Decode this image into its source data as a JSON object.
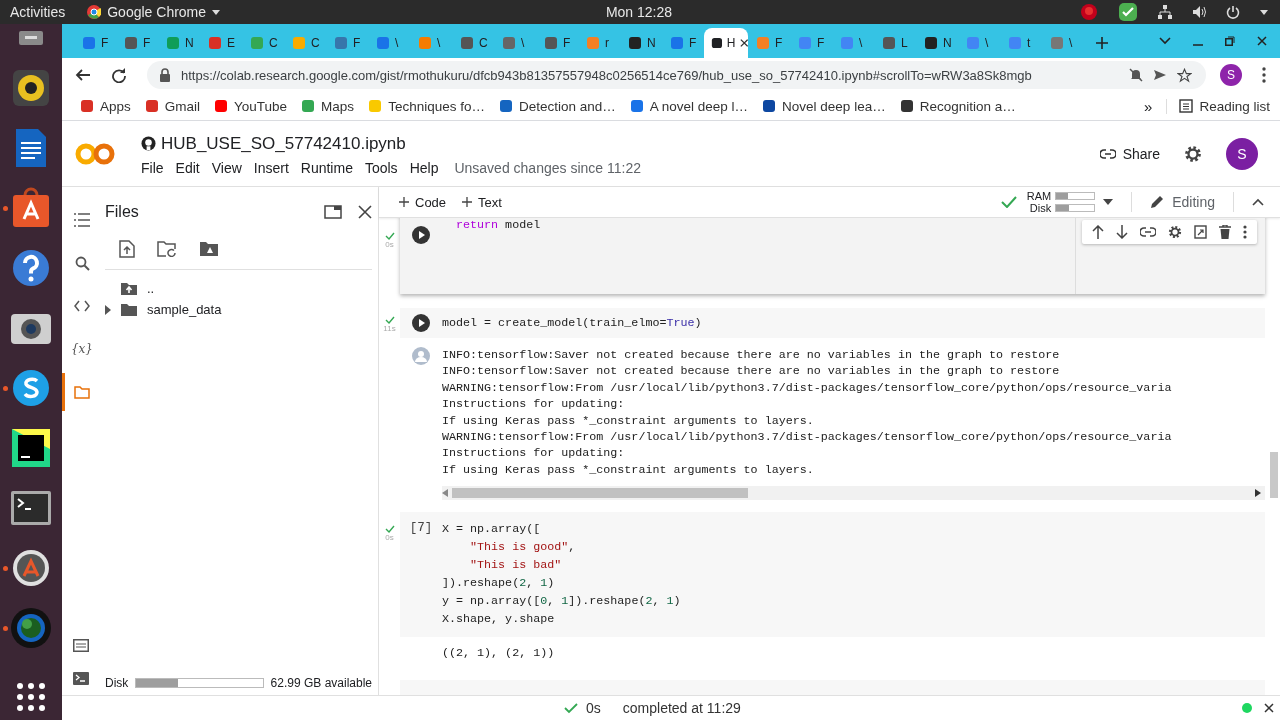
{
  "topbar": {
    "activities": "Activities",
    "app": "Google Chrome",
    "clock": "Mon 12:28"
  },
  "dock": [
    {
      "running": false
    },
    {
      "running": false
    },
    {
      "running": false
    },
    {
      "running": true
    },
    {
      "running": false
    },
    {
      "running": false
    },
    {
      "running": true
    },
    {
      "running": false
    },
    {
      "running": false
    },
    {
      "running": true
    },
    {
      "running": true
    }
  ],
  "tabs": [
    {
      "label": "F",
      "selected": false
    },
    {
      "label": "F",
      "selected": false
    },
    {
      "label": "N",
      "selected": false
    },
    {
      "label": "E",
      "selected": false
    },
    {
      "label": "C",
      "selected": false
    },
    {
      "label": "C",
      "selected": false
    },
    {
      "label": "F",
      "selected": false
    },
    {
      "label": "\\",
      "selected": false
    },
    {
      "label": "\\",
      "selected": false
    },
    {
      "label": "C",
      "selected": false
    },
    {
      "label": "\\",
      "selected": false
    },
    {
      "label": "F",
      "selected": false
    },
    {
      "label": "r",
      "selected": false
    },
    {
      "label": "N",
      "selected": false
    },
    {
      "label": "F",
      "selected": false
    },
    {
      "label": "H",
      "selected": true
    },
    {
      "label": "F",
      "selected": false
    },
    {
      "label": "F",
      "selected": false
    },
    {
      "label": "\\",
      "selected": false
    },
    {
      "label": "L",
      "selected": false
    },
    {
      "label": "N",
      "selected": false
    },
    {
      "label": "\\",
      "selected": false
    },
    {
      "label": "t",
      "selected": false
    },
    {
      "label": "\\",
      "selected": false
    }
  ],
  "address": {
    "url": "https://colab.research.google.com/gist/rmothukuru/dfcb943b81357557948c0256514ce769/hub_use_so_57742410.ipynb#scrollTo=wRW3a8Sk8mgb",
    "profile": "S"
  },
  "bookmarks": [
    {
      "label": "Apps"
    },
    {
      "label": "Gmail"
    },
    {
      "label": "YouTube"
    },
    {
      "label": "Maps"
    },
    {
      "label": "Techniques fo…"
    },
    {
      "label": "Detection and…"
    },
    {
      "label": "A novel deep l…"
    },
    {
      "label": "Novel deep lea…"
    },
    {
      "label": "Recognition a…"
    }
  ],
  "bookmarks_more": "»",
  "reading_list": "Reading list",
  "notebook": {
    "title": "HUB_USE_SO_57742410.ipynb",
    "menu": [
      "File",
      "Edit",
      "View",
      "Insert",
      "Runtime",
      "Tools",
      "Help"
    ],
    "unsaved": "Unsaved changes since 11:22",
    "share": "Share",
    "avatar": "S"
  },
  "toolbar": {
    "add_code": "Code",
    "add_text": "Text",
    "ram": {
      "label": "RAM",
      "level": 0.3
    },
    "disk": {
      "label": "Disk",
      "level": 0.35
    },
    "mode": "Editing"
  },
  "rail": [
    {
      "selected": false
    },
    {
      "selected": false
    },
    {
      "selected": false
    },
    {
      "glyph": "{x}",
      "selected": false
    },
    {
      "selected": true
    }
  ],
  "files": {
    "title": "Files",
    "tree": [
      {
        "name": "..",
        "kind": "parent"
      },
      {
        "name": "sample_data",
        "kind": "folder",
        "expanded": false
      }
    ],
    "disk": {
      "label": "Disk",
      "level": 0.33,
      "available": "62.99 GB available"
    }
  },
  "cells": [
    {
      "time": "0s",
      "focused": true,
      "lines": [
        [
          {
            "t": "  return",
            "kind": "keyword"
          },
          {
            "t": " model",
            "kind": "plain"
          }
        ]
      ]
    },
    {
      "time": "11s",
      "focused": false,
      "lines": [
        [
          {
            "t": "model = create_model(train_elmo=",
            "kind": "plain"
          },
          {
            "t": "True",
            "kind": "constant"
          },
          {
            "t": ")",
            "kind": "plain"
          }
        ]
      ],
      "output": {
        "kind": "log",
        "lines": [
          "INFO:tensorflow:Saver not created because there are no variables in the graph to restore",
          "INFO:tensorflow:Saver not created because there are no variables in the graph to restore",
          "WARNING:tensorflow:From /usr/local/lib/python3.7/dist-packages/tensorflow_core/python/ops/resource_varia",
          "Instructions for updating:",
          "If using Keras pass *_constraint arguments to layers.",
          "WARNING:tensorflow:From /usr/local/lib/python3.7/dist-packages/tensorflow_core/python/ops/resource_varia",
          "Instructions for updating:",
          "If using Keras pass *_constraint arguments to layers."
        ]
      }
    },
    {
      "count": "[7]",
      "time": "0s",
      "focused": false,
      "lines": [
        [
          {
            "t": "X = np.array([",
            "kind": "plain"
          }
        ],
        [
          {
            "t": "    \"This is good\"",
            "kind": "string"
          },
          {
            "t": ",",
            "kind": "plain"
          }
        ],
        [
          {
            "t": "    \"This is bad\"",
            "kind": "string"
          }
        ],
        [
          {
            "t": "]).reshape(",
            "kind": "plain"
          },
          {
            "t": "2",
            "kind": "number"
          },
          {
            "t": ", ",
            "kind": "plain"
          },
          {
            "t": "1",
            "kind": "number"
          },
          {
            "t": ")",
            "kind": "plain"
          }
        ],
        [
          {
            "t": "y = np.array([",
            "kind": "plain"
          },
          {
            "t": "0",
            "kind": "number"
          },
          {
            "t": ", ",
            "kind": "plain"
          },
          {
            "t": "1",
            "kind": "number"
          },
          {
            "t": "]).reshape(",
            "kind": "plain"
          },
          {
            "t": "2",
            "kind": "number"
          },
          {
            "t": ", ",
            "kind": "plain"
          },
          {
            "t": "1",
            "kind": "number"
          },
          {
            "t": ")",
            "kind": "plain"
          }
        ],
        [
          {
            "t": "X.shape, y.shape",
            "kind": "plain"
          }
        ]
      ],
      "output": {
        "kind": "result",
        "lines": [
          "((2, 1), (2, 1))"
        ]
      }
    }
  ],
  "status": {
    "time": "0s",
    "text": "completed at 11:29"
  }
}
